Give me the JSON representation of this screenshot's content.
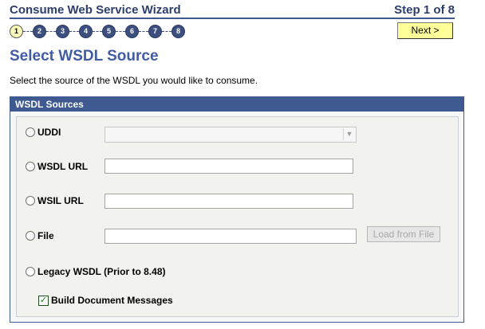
{
  "header": {
    "title": "Consume Web Service Wizard",
    "step_text": "Step 1 of 8"
  },
  "steps": [
    {
      "label": "1",
      "active": true
    },
    {
      "label": "2",
      "active": false
    },
    {
      "label": "3",
      "active": false
    },
    {
      "label": "4",
      "active": false
    },
    {
      "label": "5",
      "active": false
    },
    {
      "label": "6",
      "active": false
    },
    {
      "label": "7",
      "active": false
    },
    {
      "label": "8",
      "active": false
    }
  ],
  "buttons": {
    "next": "Next >",
    "load_from_file": "Load from File"
  },
  "page": {
    "title": "Select WSDL Source",
    "instructions": "Select the source of the WSDL you would like to consume."
  },
  "panel": {
    "header": "WSDL Sources"
  },
  "options": {
    "uddi": "UDDI",
    "wsdl_url": "WSDL URL",
    "wsil_url": "WSIL URL",
    "file": "File",
    "legacy": "Legacy WSDL (Prior to 8.48)"
  },
  "fields": {
    "uddi_selected": "",
    "wsdl_url": "",
    "wsil_url": "",
    "file": ""
  },
  "checkbox": {
    "label": "Build Document Messages",
    "checked": true
  }
}
